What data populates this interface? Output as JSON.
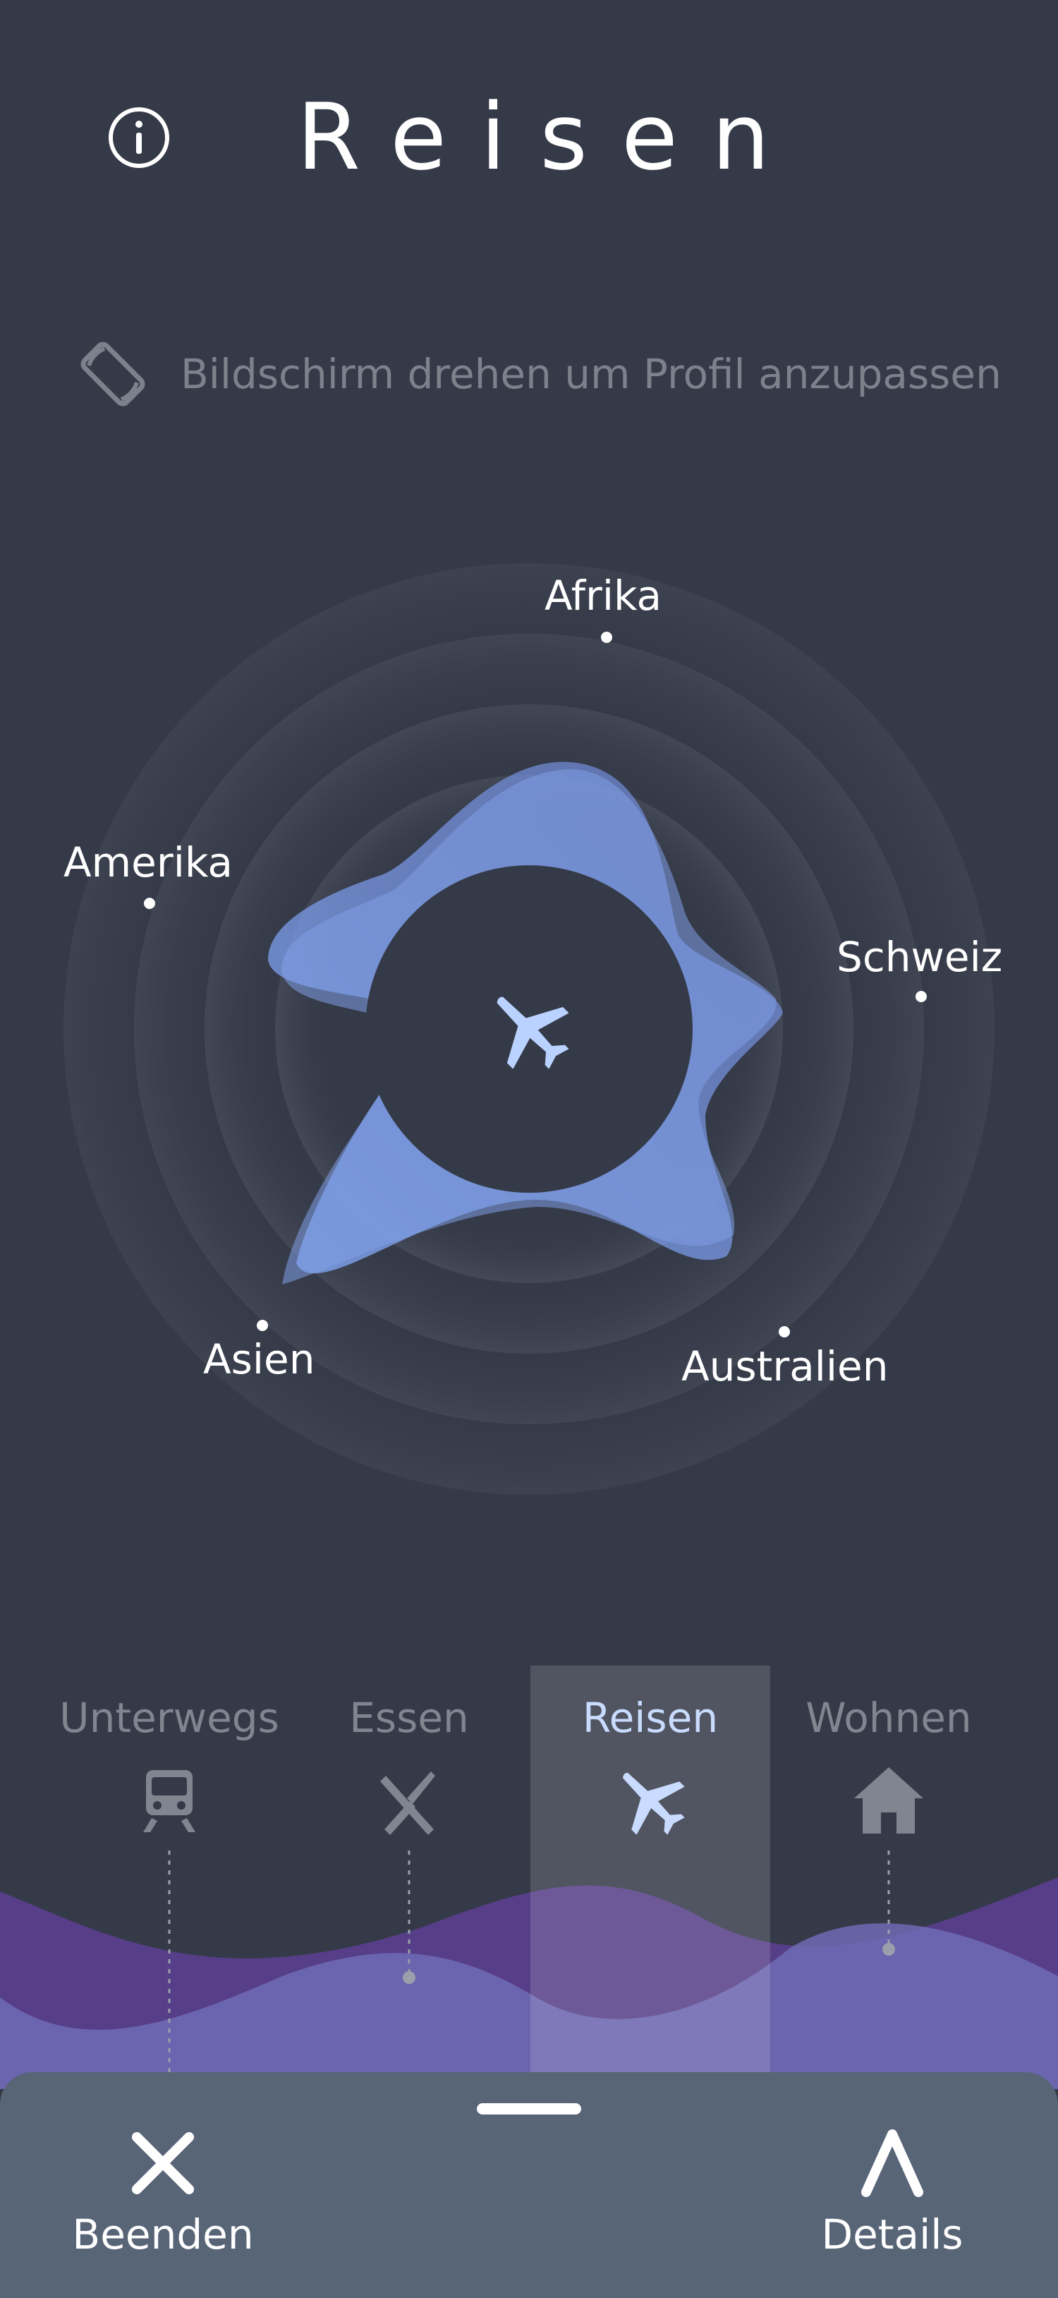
{
  "header": {
    "title": "Reisen",
    "info_icon": "info-icon"
  },
  "hint": {
    "text": "Bildschirm drehen um Profil anzupassen",
    "icon": "screen-rotation-icon"
  },
  "radar": {
    "center_icon": "airplane-icon",
    "regions": [
      "Afrika",
      "Amerika",
      "Schweiz",
      "Asien",
      "Australien"
    ]
  },
  "tabs": [
    {
      "label": "Unterwegs",
      "icon": "train-icon",
      "active": false
    },
    {
      "label": "Essen",
      "icon": "fork-knife-icon",
      "active": false
    },
    {
      "label": "Reisen",
      "icon": "airplane-icon",
      "active": true
    },
    {
      "label": "Wohnen",
      "icon": "home-icon",
      "active": false
    }
  ],
  "sheet": {
    "close_label": "Beenden",
    "details_label": "Details"
  },
  "colors": {
    "background": "#353a48",
    "blob": "#7f9ee6",
    "accent_active": "#c9dbff",
    "wave_purple": "#6a4aa0",
    "sheet": "#586577"
  }
}
